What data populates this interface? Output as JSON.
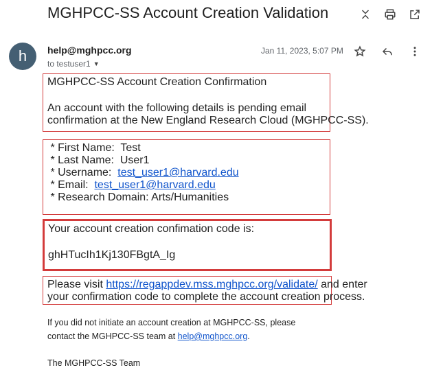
{
  "email": {
    "subject": "MGHPCC-SS Account Creation Validation",
    "sender": "help@mghpcc.org",
    "avatar_letter": "h",
    "recipient": "to testuser1",
    "date": "Jan 11, 2023, 5:07 PM",
    "intro_title": "MGHPCC-SS Account Creation Confirmation",
    "intro_line1": "An account with the following details is pending email",
    "intro_line2": "confirmation at the New England Research Cloud (MGHPCC-SS).",
    "details": {
      "first_name_label": " * First Name:  Test",
      "last_name_label": " * Last Name:  User1",
      "username_label": " * Username:  ",
      "username_value": "test_user1@harvard.edu",
      "email_label": " * Email:  ",
      "email_value": "test_user1@harvard.edu",
      "domain_label": " * Research Domain: Arts/Humanities"
    },
    "code_intro": "Your account creation confimation code is:",
    "code": "ghHTucIh1Kj130FBgtA_Ig",
    "visit_prefix": "Please visit ",
    "visit_link": "https://regappdev.mss.mghpcc.org/validate/",
    "visit_suffix": " and enter",
    "visit_line2": "your confirmation code to complete the account creation process.",
    "footer_line1": "If you did not initiate an account creation at MGHPCC-SS, please",
    "footer_line2_prefix": "contact the MGHPCC-SS team at ",
    "footer_link": "help@mghpcc.org",
    "footer_line2_suffix": ".",
    "signature": "The MGHPCC-SS Team"
  },
  "icons": [
    "collapse-icon",
    "print-icon",
    "open-in-new-icon",
    "star-icon",
    "reply-icon",
    "more-vert-icon",
    "dropdown-caret-icon"
  ]
}
